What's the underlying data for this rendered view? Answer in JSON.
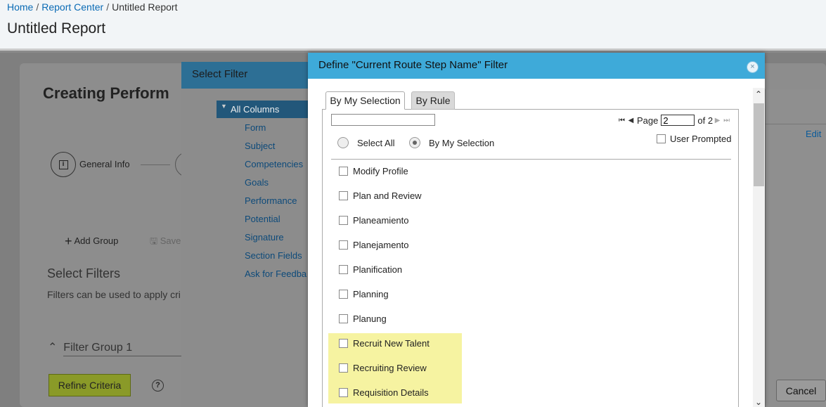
{
  "breadcrumb": {
    "home": "Home",
    "sep": "/",
    "report_center": "Report Center",
    "current": "Untitled Report"
  },
  "page_title": "Untitled Report",
  "background": {
    "heading": "Creating Perform",
    "step_icon": "i",
    "step_label": "General Info",
    "add_group": "Add Group",
    "save": "Save",
    "select_filters": "Select Filters",
    "filters_desc": "Filters can be used to apply cri",
    "filter_group": "Filter Group 1",
    "refine_criteria": "Refine Criteria",
    "help_glyph": "?",
    "edit": "Edit",
    "cancel": "Cancel"
  },
  "select_filter": {
    "title": "Select Filter",
    "active_item": "All Columns",
    "items": [
      "Form",
      "Subject",
      "Competencies",
      "Goals",
      "Performance",
      "Potential",
      "Signature",
      "Section Fields",
      "Ask for Feedba"
    ]
  },
  "modal": {
    "title": "Define \"Current Route Step Name\" Filter",
    "close_glyph": "×",
    "tabs": {
      "selection": "By My Selection",
      "rule": "By Rule"
    },
    "search_value": "",
    "pager": {
      "page_label": "Page",
      "page_value": "2",
      "of_label": "of 2"
    },
    "select_all": "Select All",
    "by_my_selection": "By My Selection",
    "user_prompted": "User Prompted",
    "options": [
      "Modify Profile",
      "Plan and Review",
      "Planeamiento",
      "Planejamento",
      "Planification",
      "Planning",
      "Planung",
      "Recruit New Talent",
      "Recruiting Review",
      "Requisition Details"
    ],
    "highlight_color": "#f6f3a1"
  }
}
